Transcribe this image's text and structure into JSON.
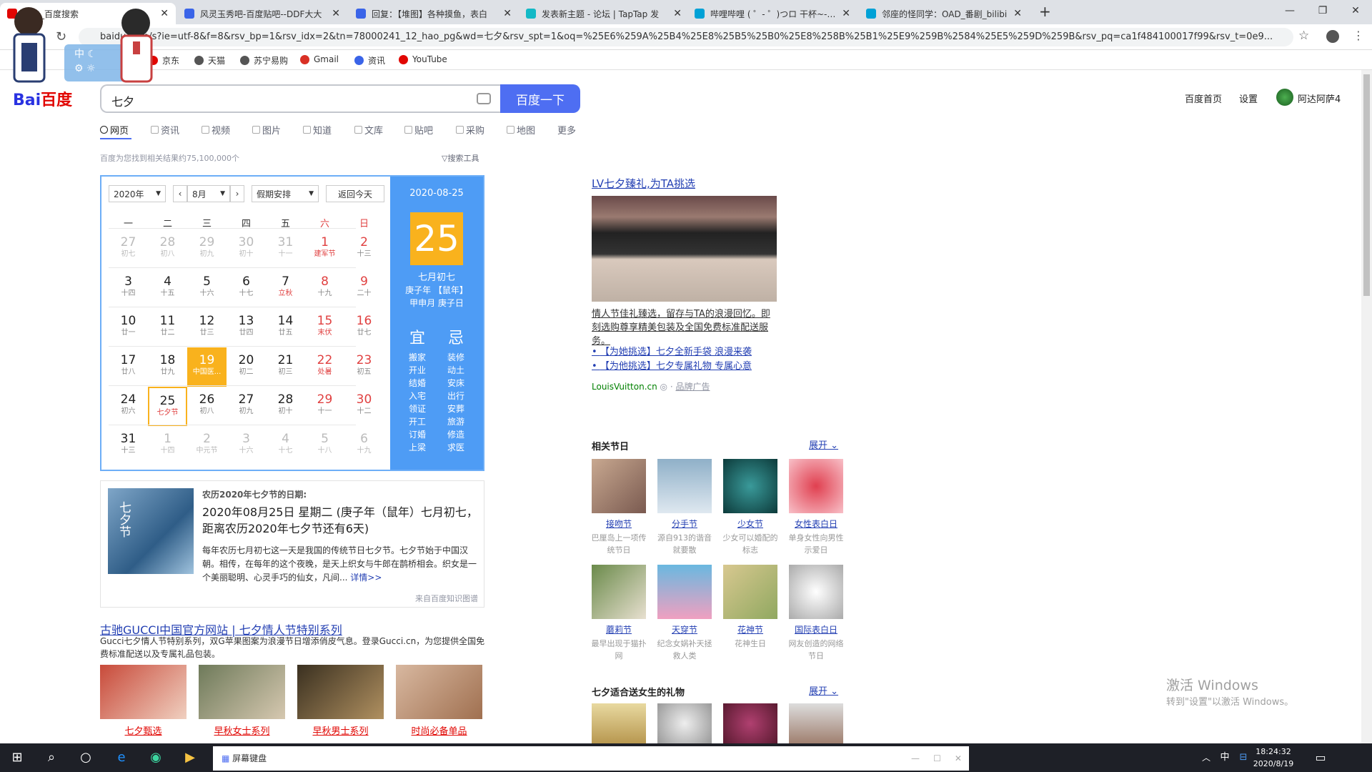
{
  "tabs": [
    {
      "label": "七夕_百度搜索",
      "active": true
    },
    {
      "label": "风灵玉秀吧-百度贴吧--DDF大大"
    },
    {
      "label": "回复：【堆图】各种摸鱼，表白"
    },
    {
      "label": "发表新主题 - 论坛 | TapTap 发"
    },
    {
      "label": "哔哩哔哩 ( ゜- ゜)つロ 干杯~-bili"
    },
    {
      "label": "邻座的怪同学：OAD_番剧_bilibi"
    }
  ],
  "window": {
    "min": "—",
    "max": "❐",
    "close": "✕"
  },
  "address": {
    "url": "baidu.com/s?ie=utf-8&f=8&rsv_bp=1&rsv_idx=2&tn=78000241_12_hao_pg&wd=七夕&rsv_spt=1&oq=%25E6%259A%25B4%25E8%25B5%25B0%25E8%258B%25B1%25E9%259B%2584%25E5%259D%259B&rsv_pq=ca1f484100017f99&rsv_t=0e9..."
  },
  "bookmarks": [
    "京东",
    "天猫",
    "苏宁易购",
    "Gmail",
    "资讯",
    "YouTube"
  ],
  "header": {
    "logo_a": "Bai",
    "logo_b": "百度",
    "query": "七夕",
    "search_btn": "百度一下",
    "links": [
      "百度首页",
      "设置"
    ],
    "user": "阿达阿萨4"
  },
  "nav": [
    "网页",
    "资讯",
    "视频",
    "图片",
    "知道",
    "文库",
    "贴吧",
    "采购",
    "地图",
    "更多"
  ],
  "results": {
    "count": "百度为您找到相关结果约75,100,000个",
    "tools": "搜索工具"
  },
  "calendar": {
    "year": "2020年",
    "month": "8月",
    "holiday": "假期安排",
    "today_btn": "返回今天",
    "weekdays": [
      "一",
      "二",
      "三",
      "四",
      "五",
      "六",
      "日"
    ],
    "rows": [
      [
        {
          "d": "27",
          "l": "初七",
          "g": 1
        },
        {
          "d": "28",
          "l": "初八",
          "g": 1
        },
        {
          "d": "29",
          "l": "初九",
          "g": 1
        },
        {
          "d": "30",
          "l": "初十",
          "g": 1
        },
        {
          "d": "31",
          "l": "十一",
          "g": 1
        },
        {
          "d": "1",
          "l": "建军节",
          "r": 1
        },
        {
          "d": "2",
          "l": "十三"
        }
      ],
      [
        {
          "d": "3",
          "l": "十四"
        },
        {
          "d": "4",
          "l": "十五"
        },
        {
          "d": "5",
          "l": "十六"
        },
        {
          "d": "6",
          "l": "十七"
        },
        {
          "d": "7",
          "l": "立秋",
          "r": 1
        },
        {
          "d": "8",
          "l": "十九"
        },
        {
          "d": "9",
          "l": "二十"
        }
      ],
      [
        {
          "d": "10",
          "l": "廿一"
        },
        {
          "d": "11",
          "l": "廿二"
        },
        {
          "d": "12",
          "l": "廿三"
        },
        {
          "d": "13",
          "l": "廿四"
        },
        {
          "d": "14",
          "l": "廿五"
        },
        {
          "d": "15",
          "l": "末伏",
          "r": 1
        },
        {
          "d": "16",
          "l": "廿七"
        }
      ],
      [
        {
          "d": "17",
          "l": "廿八"
        },
        {
          "d": "18",
          "l": "廿九"
        },
        {
          "d": "19",
          "l": "中国医...",
          "t": 1
        },
        {
          "d": "20",
          "l": "初二"
        },
        {
          "d": "21",
          "l": "初三"
        },
        {
          "d": "22",
          "l": "处暑",
          "r": 1
        },
        {
          "d": "23",
          "l": "初五"
        }
      ],
      [
        {
          "d": "24",
          "l": "初六"
        },
        {
          "d": "25",
          "l": "七夕节",
          "s": 1
        },
        {
          "d": "26",
          "l": "初八"
        },
        {
          "d": "27",
          "l": "初九"
        },
        {
          "d": "28",
          "l": "初十"
        },
        {
          "d": "29",
          "l": "十一"
        },
        {
          "d": "30",
          "l": "十二"
        }
      ],
      [
        {
          "d": "31",
          "l": "十三"
        },
        {
          "d": "1",
          "l": "十四",
          "g": 1
        },
        {
          "d": "2",
          "l": "中元节",
          "g": 1
        },
        {
          "d": "3",
          "l": "十六",
          "g": 1
        },
        {
          "d": "4",
          "l": "十七",
          "g": 1
        },
        {
          "d": "5",
          "l": "十八",
          "g": 1
        },
        {
          "d": "6",
          "l": "十九",
          "g": 1
        }
      ]
    ],
    "side": {
      "date": "2020-08-25",
      "day": "25",
      "lunar": "七月初七",
      "year_gz": "庚子年 【鼠年】",
      "month_gz": "甲申月 庚子日",
      "yi": "宜",
      "ji": "忌",
      "yi_list": [
        "搬家",
        "开业",
        "结婚",
        "入宅",
        "领证",
        "开工",
        "订婚",
        "上梁"
      ],
      "ji_list": [
        "装修",
        "动土",
        "安床",
        "出行",
        "安葬",
        "旅游",
        "修造",
        "求医"
      ]
    }
  },
  "card": {
    "title": "农历2020年七夕节的日期:",
    "main": "2020年08月25日 星期二 (庚子年（鼠年）七月初七，距离农历2020年七夕节还有6天)",
    "body": "每年农历七月初七这一天是我国的传统节日七夕节。七夕节始于中国汉朝。相传，在每年的这个夜晚，是天上织女与牛郎在鹊桥相会。织女是一个美丽聪明、心灵手巧的仙女，凡间...",
    "more": "详情>>",
    "source": "来自百度知识图谱",
    "img_text": "七夕节"
  },
  "gucci": {
    "title": "古驰GUCCI中国官方网站 | 七夕情人节特别系列",
    "desc": "Gucci七夕情人节特别系列，双G苹果图案为浪漫节日增添俏皮气息。登录Gucci.cn，为您提供全国免费标准配送以及专属礼品包装。",
    "items": [
      "七夕甄选",
      "早秋女士系列",
      "早秋男士系列",
      "时尚必备单品"
    ]
  },
  "lv": {
    "title": "LV七夕臻礼,为TA挑选",
    "desc": "情人节佳礼臻选，留存与TA的浪漫回忆。即刻选购尊享精美包装及全国免费标准配送服务。",
    "links": [
      "【为她挑选】七夕全新手袋 浪漫来袭",
      "【为他挑选】七夕专属礼物 专属心意"
    ],
    "site": "LouisVuitton.cn",
    "ad": "品牌广告"
  },
  "festivals": {
    "title": "相关节日",
    "expand": "展开",
    "items": [
      {
        "n": "接吻节",
        "d": "巴厘岛上一项传统节日"
      },
      {
        "n": "分手节",
        "d": "源自913的谐音就要散"
      },
      {
        "n": "少女节",
        "d": "少女可以婚配的标志"
      },
      {
        "n": "女性表白日",
        "d": "单身女性向男性示爱日"
      },
      {
        "n": "蘑莉节",
        "d": "最早出现于猫扑网"
      },
      {
        "n": "天穿节",
        "d": "纪念女娲补天拯救人类"
      },
      {
        "n": "花神节",
        "d": "花神生日"
      },
      {
        "n": "国际表白日",
        "d": "网友创造的网络节日"
      }
    ]
  },
  "gifts": {
    "title": "七夕适合送女生的礼物",
    "expand": "展开"
  },
  "watermark": {
    "l1": "激活 Windows",
    "l2": "转到\"设置\"以激活 Windows。"
  },
  "taskbar": {
    "kbd": "屏幕键盘",
    "ime": "中",
    "time": "18:24:32",
    "date": "2020/8/19"
  }
}
